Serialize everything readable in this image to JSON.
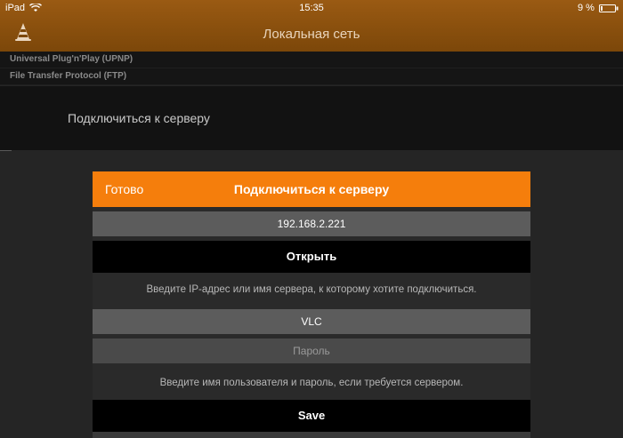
{
  "status_bar": {
    "device": "iPad",
    "time": "15:35",
    "battery": "9 %"
  },
  "nav": {
    "title": "Локальная сеть"
  },
  "sections": [
    {
      "label": "Universal Plug'n'Play (UPNP)"
    },
    {
      "label": "File Transfer Protocol (FTP)"
    }
  ],
  "server_item": {
    "label": "Подключиться к серверу"
  },
  "dialog": {
    "done_label": "Готово",
    "title": "Подключиться к серверу",
    "address_value": "192.168.2.221",
    "open_label": "Открыть",
    "address_hint": "Введите IP-адрес или имя сервера, к которому хотите подключиться.",
    "username_value": "VLC",
    "password_placeholder": "Пароль",
    "credentials_hint": "Введите имя пользователя и пароль, если требуется сервером.",
    "save_label": "Save"
  },
  "colors": {
    "accent": "#f57e0c",
    "navbar": "#8a4f0f"
  }
}
